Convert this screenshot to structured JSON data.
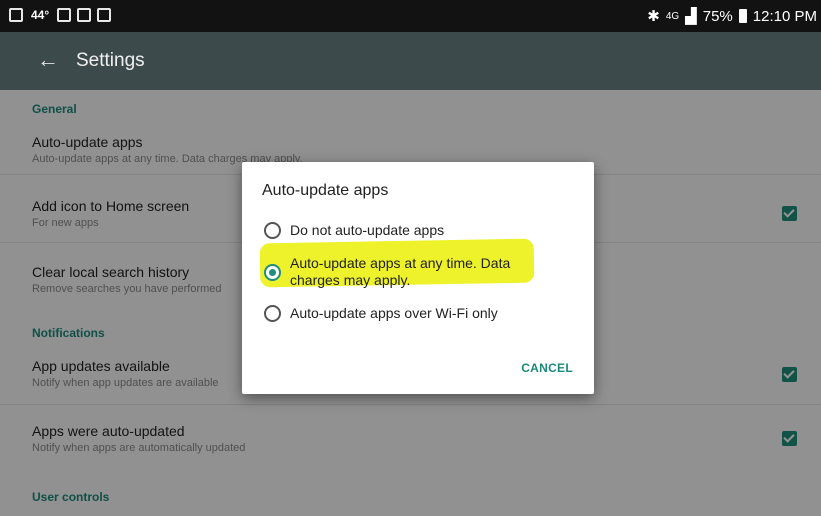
{
  "statusbar": {
    "temperature": "44°",
    "signal_text": "4G",
    "battery": "75%",
    "time": "12:10 PM"
  },
  "appbar": {
    "back_glyph": "←",
    "title": "Settings"
  },
  "settings": {
    "section_general": "General",
    "auto_update_title": "Auto-update apps",
    "auto_update_sub": "Auto-update apps at any time. Data charges may apply.",
    "add_icon_title": "Add icon to Home screen",
    "add_icon_sub": "For new apps",
    "add_icon_checked": true,
    "clear_history_title": "Clear local search history",
    "clear_history_sub": "Remove searches you have performed",
    "section_notifications": "Notifications",
    "app_updates_title": "App updates available",
    "app_updates_sub": "Notify when app updates are available",
    "app_updates_checked": true,
    "apps_updated_title": "Apps were auto-updated",
    "apps_updated_sub": "Notify when apps are automatically updated",
    "apps_updated_checked": true,
    "section_user_controls": "User controls"
  },
  "dialog": {
    "title": "Auto-update apps",
    "options": [
      {
        "label": "Do not auto-update apps",
        "selected": false
      },
      {
        "label": "Auto-update apps at any time. Data charges may apply.",
        "selected": true
      },
      {
        "label": "Auto-update apps over Wi-Fi only",
        "selected": false
      }
    ],
    "cancel": "CANCEL"
  },
  "colors": {
    "accent": "#1f8f7d",
    "appbar": "#3d4a4b",
    "highlight": "#eef22a"
  }
}
